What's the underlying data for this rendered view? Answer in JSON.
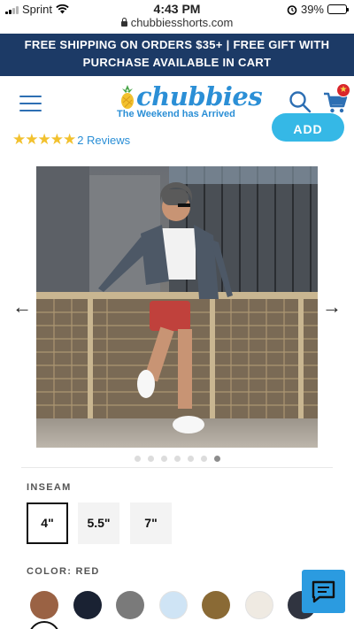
{
  "status_bar": {
    "carrier": "Sprint",
    "time": "4:43 PM",
    "battery": "39%",
    "battery_level": 0.39
  },
  "browser": {
    "url": "chubbiesshorts.com"
  },
  "promo_banner": {
    "line1": "FREE SHIPPING ON ORDERS $35+ | FREE GIFT WITH",
    "line2": "PURCHASE AVAILABLE IN CART"
  },
  "header": {
    "logo_text": "chubbies",
    "tagline": "The Weekend has Arrived",
    "brand_color": "#2b8fd6",
    "icons": [
      "menu-icon",
      "search-icon",
      "cart-icon",
      "star-badge-icon"
    ]
  },
  "product": {
    "rating": 5,
    "stars": "★★★★★",
    "reviews_label": "2 Reviews",
    "add_button_label": "ADD",
    "gallery": {
      "image_count": 7,
      "active_index": 6,
      "prev_arrow": "←",
      "next_arrow": "→"
    },
    "inseam": {
      "label": "INSEAM",
      "options": [
        "4\"",
        "5.5\"",
        "7\""
      ],
      "selected": "4\""
    },
    "color": {
      "label": "COLOR: RED",
      "swatches": [
        "#9a6244",
        "#1a2233",
        "#7a7a7a",
        "#cfe4f5",
        "#8a6a35",
        "#efeae2",
        "#303440"
      ]
    }
  },
  "chat": {
    "icon": "chat-icon",
    "color": "#2b9be0"
  }
}
